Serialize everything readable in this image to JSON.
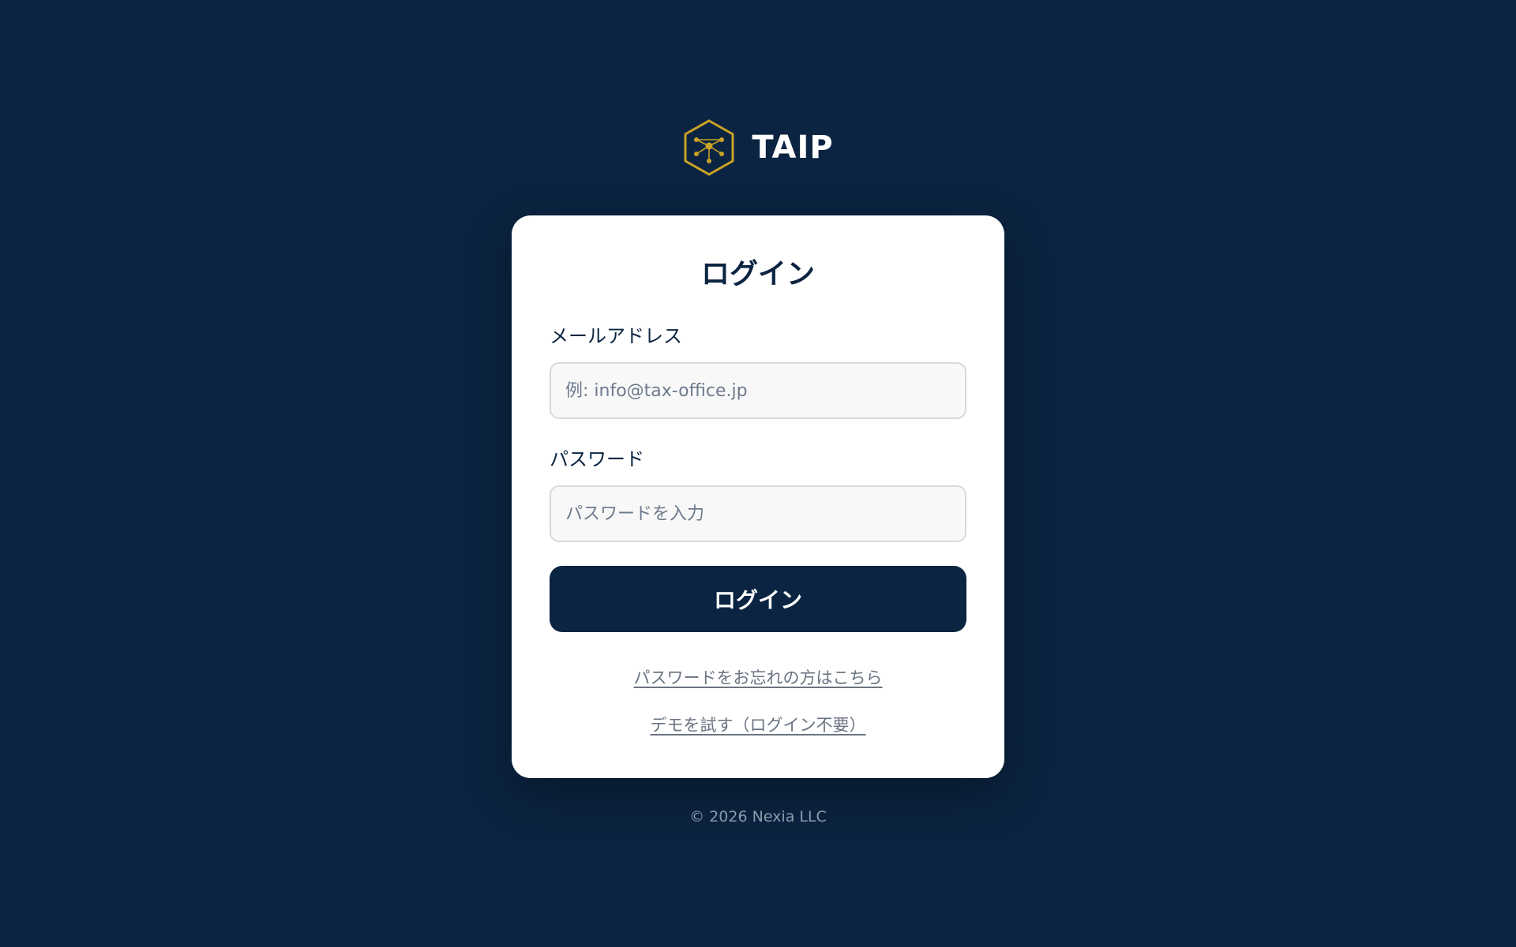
{
  "brand": {
    "name": "TAIP",
    "logo_icon": "hexagon-network-icon",
    "logo_color": "#c9a227"
  },
  "login": {
    "title": "ログイン",
    "email": {
      "label": "メールアドレス",
      "placeholder": "例: info@tax-office.jp",
      "value": ""
    },
    "password": {
      "label": "パスワード",
      "placeholder": "パスワードを入力",
      "value": ""
    },
    "submit_label": "ログイン",
    "forgot_password_link": "パスワードをお忘れの方はこちら",
    "demo_link": "デモを試す（ログイン不要）"
  },
  "footer": {
    "copyright": "© 2026 Nexia LLC"
  },
  "colors": {
    "background": "#0b2441",
    "card": "#ffffff",
    "primary": "#0b2441",
    "accent": "#c9a227",
    "link": "#6a7381"
  }
}
